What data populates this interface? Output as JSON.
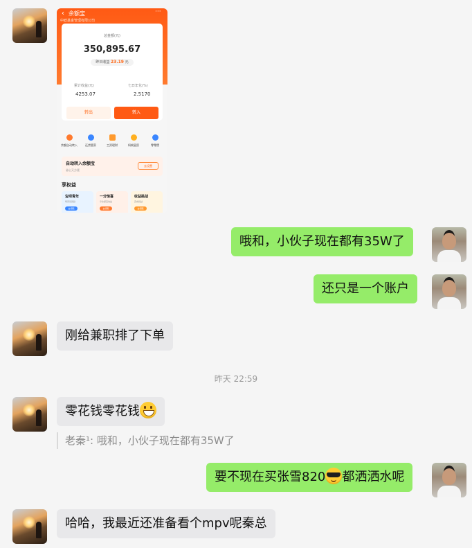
{
  "phone": {
    "back": "‹",
    "title": "余额宝",
    "subtitle": "中欧基金管理有限公司",
    "more": "···",
    "total_label": "总金额(元)",
    "total": "350,895.67",
    "yesterday_label": "昨日收益",
    "yesterday_value": "23.19",
    "yesterday_unit": "元",
    "cum_label": "累计收益(元)",
    "cum_value": "4253.07",
    "rate_label": "七日年化(%)",
    "rate_value": "2.5170",
    "btn_out": "转出",
    "btn_in": "转入",
    "icons": [
      {
        "label": "余额自动转入",
        "color": "#ff7a2e"
      },
      {
        "label": "还贷管家",
        "color": "#3a86ff"
      },
      {
        "label": "工资理财",
        "color": "#ff9a2e"
      },
      {
        "label": "蚂蚁星愿",
        "color": "#ffb020"
      },
      {
        "label": "零零攒",
        "color": "#3a86ff"
      }
    ],
    "auto_title": "自动转入余额宝",
    "auto_sub": "省心又方便",
    "auto_btn": "去设置",
    "section_title": "享权益",
    "benefits": [
      {
        "title": "宝呗青年",
        "sub": "每周领奖励",
        "badge": "去领取",
        "bg": "#e8f3ff",
        "badge_color": "#3a86ff"
      },
      {
        "title": "一分惊喜",
        "sub": "享余额宝收益",
        "badge": "去领取",
        "bg": "#fff0e8",
        "badge_color": "#ff7a2e"
      },
      {
        "title": "收益挑战",
        "sub": "完成挑战",
        "badge": "去领取",
        "bg": "#fff5e0",
        "badge_color": "#ff9a2e"
      }
    ]
  },
  "messages": {
    "m1": "哦和，小伙子现在都有35W了",
    "m2": "还只是一个账户",
    "m3": "刚给兼职排了下单",
    "time": "昨天 22:59",
    "m4": "零花钱零花钱",
    "quote": "老秦¹: 哦和，小伙子现在都有35W了",
    "m5a": "要不现在买张雪820",
    "m5b": "都洒洒水呢",
    "m6": "哈哈，我最近还准备看个mpv呢秦总"
  },
  "colors": {
    "outgoing_bubble": "#95ec69",
    "incoming_bubble": "#e8e8ea",
    "alipay_orange": "#ff5a14"
  }
}
